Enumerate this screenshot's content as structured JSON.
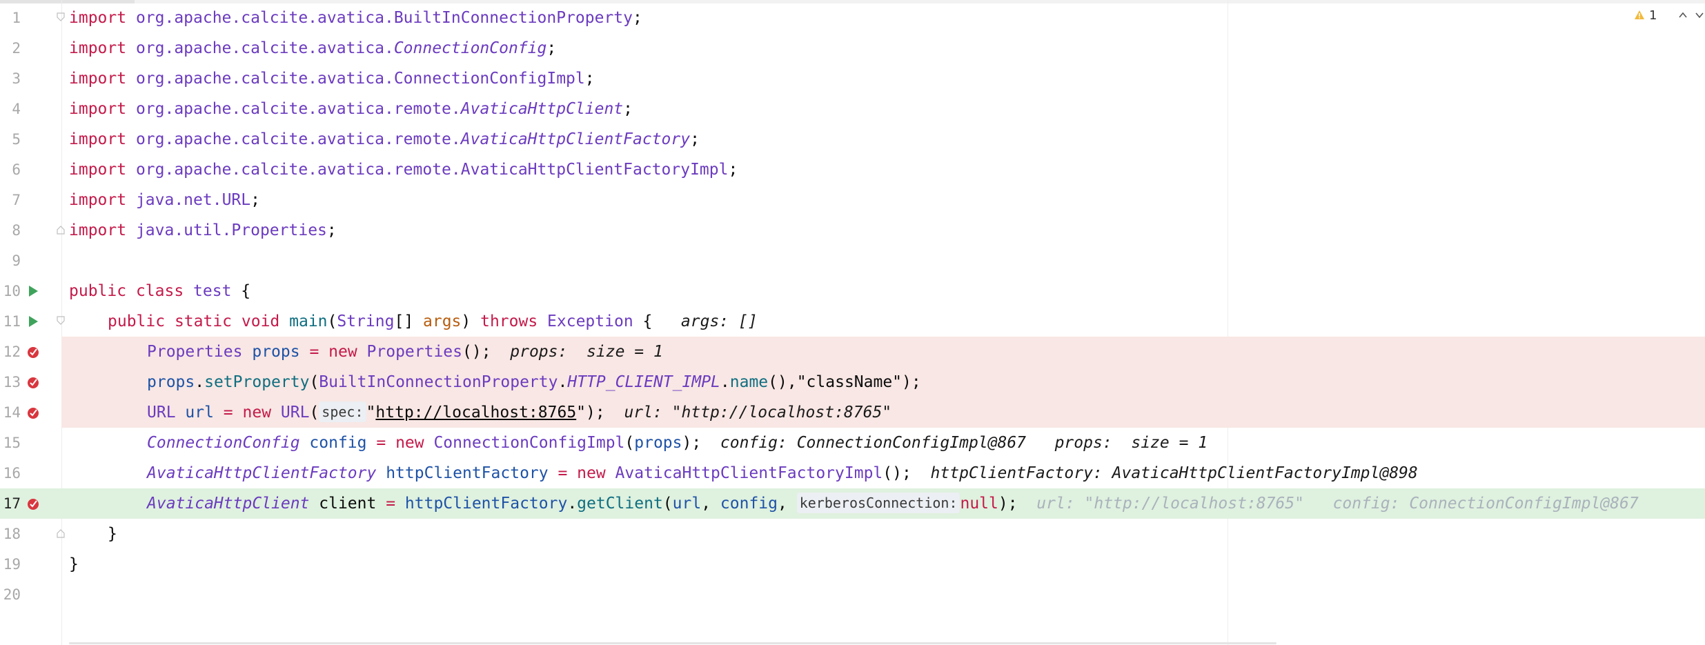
{
  "editor": {
    "warnings_count": "1",
    "lines": [
      {
        "num": "1",
        "kw": "import ",
        "pkg": "org.apache.calcite.avatica.",
        "cls": "BuiltInConnectionProperty",
        "end": ";"
      },
      {
        "num": "2",
        "kw": "import ",
        "pkg": "org.apache.calcite.avatica.",
        "cls": "ConnectionConfig",
        "end": ";"
      },
      {
        "num": "3",
        "kw": "import ",
        "pkg": "org.apache.calcite.avatica.",
        "cls": "ConnectionConfigImpl",
        "end": ";"
      },
      {
        "num": "4",
        "kw": "import ",
        "pkg": "org.apache.calcite.avatica.remote.",
        "cls": "AvaticaHttpClient",
        "end": ";"
      },
      {
        "num": "5",
        "kw": "import ",
        "pkg": "org.apache.calcite.avatica.remote.",
        "cls": "AvaticaHttpClientFactory",
        "end": ";"
      },
      {
        "num": "6",
        "kw": "import ",
        "pkg": "org.apache.calcite.avatica.remote.",
        "cls": "AvaticaHttpClientFactoryImpl",
        "end": ";"
      },
      {
        "num": "7",
        "kw": "import ",
        "pkg": "java.net.",
        "cls": "URL",
        "end": ";"
      },
      {
        "num": "8",
        "kw": "import ",
        "pkg": "java.util.",
        "cls": "Properties",
        "end": ";"
      },
      {
        "num": "9"
      },
      {
        "num": "10",
        "kw1": "public ",
        "kw2": "class ",
        "name": "test",
        "end": " {"
      },
      {
        "num": "11",
        "kw1": "public ",
        "kw2": "static ",
        "kw3": "void ",
        "method": "main",
        "open": "(",
        "type": "String",
        "arr": "[] ",
        "param": "args",
        "close": ") ",
        "kw4": "throws ",
        "exc": "Exception",
        "brace": " {",
        "hint": "args: []"
      },
      {
        "num": "12",
        "type": "Properties",
        "var": "props",
        "eq": " = ",
        "kw": "new ",
        "ctor": "Properties",
        "end": "();",
        "hint": "props:  size = 1"
      },
      {
        "num": "13",
        "var": "props",
        "dot": ".",
        "method": "setProperty",
        "open": "(",
        "cls": "BuiltInConnectionProperty",
        "dot2": ".",
        "field": "HTTP_CLIENT_IMPL",
        "dot3": ".",
        "method2": "name",
        "mid": "(),",
        "str": "\"className\"",
        "end": ");"
      },
      {
        "num": "14",
        "type": "URL",
        "var": "url",
        "eq": " = ",
        "kw": "new ",
        "ctor": "URL",
        "open": "(",
        "phint": "spec:",
        "q1": "\"",
        "str": "http://localhost:8765",
        "q2": "\"",
        "end": ");",
        "hint": "url: \"http://localhost:8765\""
      },
      {
        "num": "15",
        "type": "ConnectionConfig",
        "var": "config",
        "eq": " = ",
        "kw": "new ",
        "ctor": "ConnectionConfigImpl",
        "open": "(",
        "arg": "props",
        "end": ");",
        "hint1": "config: ConnectionConfigImpl@867",
        "hint2": "props:  size = 1"
      },
      {
        "num": "16",
        "type": "AvaticaHttpClientFactory",
        "var": "httpClientFactory",
        "eq": " = ",
        "kw": "new ",
        "ctor": "AvaticaHttpClientFactoryImpl",
        "end": "();",
        "hint": "httpClientFactory: AvaticaHttpClientFactoryImpl@898"
      },
      {
        "num": "17",
        "type": "AvaticaHttpClient",
        "var": "client",
        "eq": " = ",
        "obj": "httpClientFactory",
        "dot": ".",
        "method": "getClient",
        "open": "(",
        "arg1": "url",
        "sep1": ", ",
        "arg2": "config",
        "sep2": ", ",
        "phint": "kerberosConnection:",
        "kw": "null",
        "end": ");",
        "hint1": "url: \"http://localhost:8765\"",
        "hint2": "config: ConnectionConfigImpl@867"
      },
      {
        "num": "18",
        "text": "}"
      },
      {
        "num": "19",
        "text": "}"
      },
      {
        "num": "20"
      }
    ]
  },
  "colors": {
    "breakpoint_line": "#f8e7e4",
    "execution_line": "#dff1df",
    "breakpoint": "#d9363e",
    "run_icon": "#3fa35c",
    "keyword": "#c41a4a",
    "type": "#6b3bbf",
    "variable": "#1e52a6",
    "parameter": "#b85d0e",
    "method": "#0f6e80"
  },
  "icons": {
    "run": "run-gutter-icon",
    "breakpoint": "breakpoint-icon",
    "fold": "fold-icon",
    "warning": "warning-icon",
    "up": "chevron-up-icon",
    "down": "chevron-down-icon"
  }
}
